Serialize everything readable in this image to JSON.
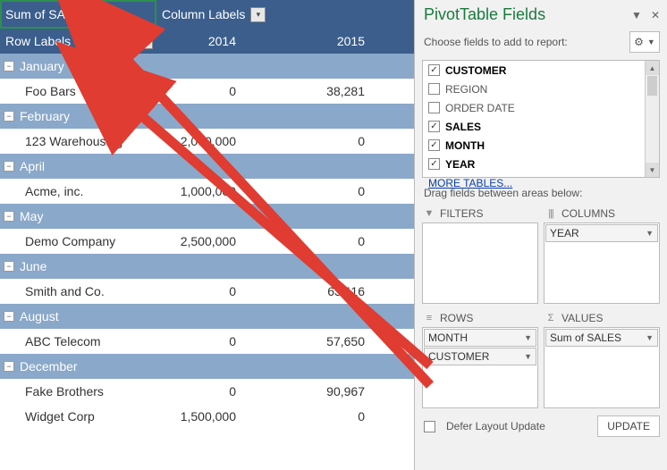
{
  "pivot": {
    "header": {
      "col0": "Sum of SALES",
      "col1": "Column Labels"
    },
    "rowlabels_label": "Row Labels",
    "years": {
      "y2014": "2014",
      "y2015": "2015"
    },
    "groups": [
      {
        "month": "January",
        "rows": [
          {
            "name": "Foo Bars",
            "v2014": "0",
            "v2015": "38,281"
          }
        ]
      },
      {
        "month": "February",
        "rows": [
          {
            "name": "123 Warehousing",
            "v2014": "2,000,000",
            "v2015": "0"
          }
        ]
      },
      {
        "month": "April",
        "rows": [
          {
            "name": "Acme, inc.",
            "v2014": "1,000,000",
            "v2015": "0"
          }
        ]
      },
      {
        "month": "May",
        "rows": [
          {
            "name": "Demo Company",
            "v2014": "2,500,000",
            "v2015": "0"
          }
        ]
      },
      {
        "month": "June",
        "rows": [
          {
            "name": "Smith and Co.",
            "v2014": "0",
            "v2015": "63,116"
          }
        ]
      },
      {
        "month": "August",
        "rows": [
          {
            "name": "ABC Telecom",
            "v2014": "0",
            "v2015": "57,650"
          }
        ]
      },
      {
        "month": "December",
        "rows": [
          {
            "name": "Fake Brothers",
            "v2014": "0",
            "v2015": "90,967"
          },
          {
            "name": "Widget Corp",
            "v2014": "1,500,000",
            "v2015": "0"
          }
        ]
      }
    ]
  },
  "pane": {
    "title": "PivotTable Fields",
    "subtitle": "Choose fields to add to report:",
    "fields": [
      {
        "label": "CUSTOMER",
        "checked": true
      },
      {
        "label": "REGION",
        "checked": false
      },
      {
        "label": "ORDER DATE",
        "checked": false
      },
      {
        "label": "SALES",
        "checked": true
      },
      {
        "label": "MONTH",
        "checked": true
      },
      {
        "label": "YEAR",
        "checked": true
      }
    ],
    "more_tables": "MORE TABLES...",
    "drag_label": "Drag fields between areas below:",
    "areas": {
      "filters_label": "FILTERS",
      "columns_label": "COLUMNS",
      "rows_label": "ROWS",
      "values_label": "VALUES",
      "columns_items": [
        "YEAR"
      ],
      "rows_items": [
        "MONTH",
        "CUSTOMER"
      ],
      "values_items": [
        "Sum of SALES"
      ]
    },
    "defer_label": "Defer Layout Update",
    "update_label": "UPDATE"
  }
}
